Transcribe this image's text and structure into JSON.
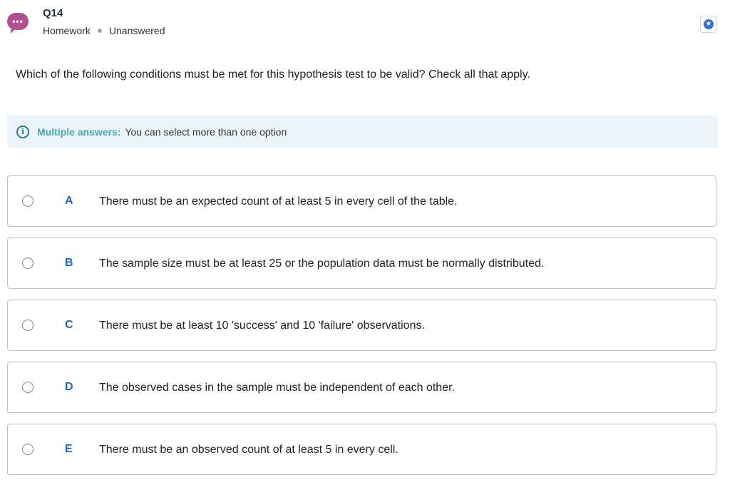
{
  "header": {
    "avatar_glyph": "•••",
    "question_number": "Q14",
    "category": "Homework",
    "status": "Unanswered",
    "star_icon": "star-icon"
  },
  "question": {
    "text": "Which of the following conditions must be met for this hypothesis test to be valid? Check all that apply."
  },
  "info": {
    "icon": "i",
    "title": "Multiple answers:",
    "text": "You can select more than one option"
  },
  "options": [
    {
      "letter": "A",
      "text": "There must be an expected count of at least 5 in every cell of the table."
    },
    {
      "letter": "B",
      "text": "The sample size must be at least 25 or the population data must be normally distributed."
    },
    {
      "letter": "C",
      "text": "There must be at least 10 'success' and 10 'failure' observations."
    },
    {
      "letter": "D",
      "text": "The observed cases in the sample must be independent of each other."
    },
    {
      "letter": "E",
      "text": "There must be an observed count of at least 5 in every cell."
    }
  ],
  "colors": {
    "accent": "#1f63c6",
    "info_title": "#3fa9b5",
    "avatar": "#b0508f"
  }
}
